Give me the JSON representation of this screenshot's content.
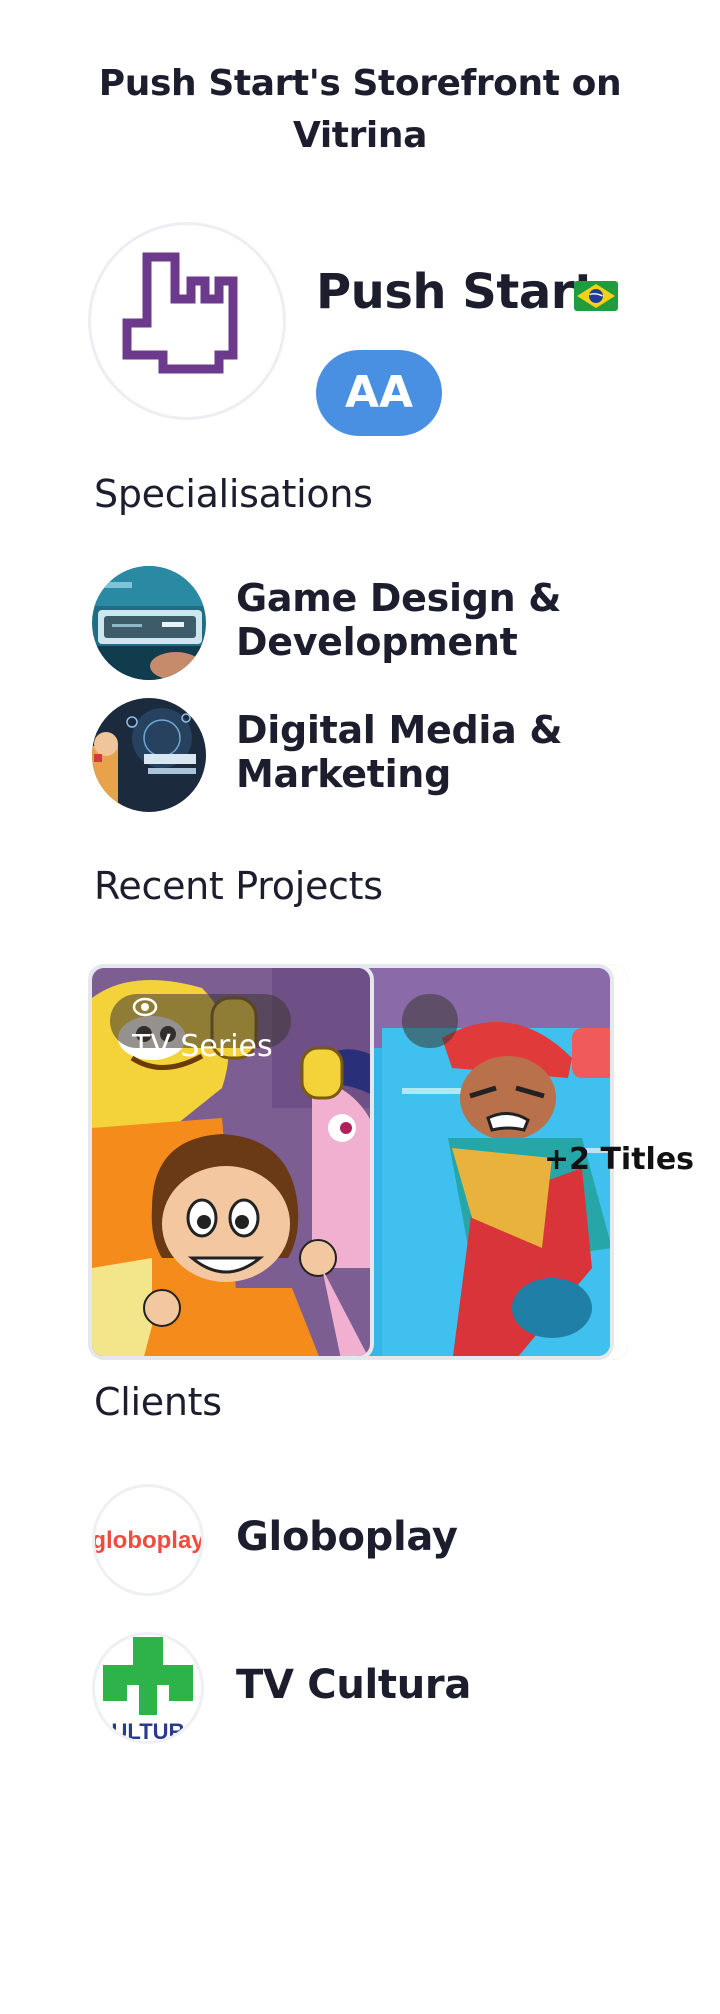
{
  "page": {
    "title_line1": "Push Start's Storefront on",
    "title_line2": "Vitrina"
  },
  "profile": {
    "name": "Push Start",
    "flag_icon": "brazil-flag",
    "badge": "AA",
    "badge_color": "#4a90e2",
    "brand_color": "#6b3a8c"
  },
  "specialisations": {
    "heading": "Specialisations",
    "items": [
      {
        "line1": "Game Design &",
        "line2": "Development"
      },
      {
        "line1": "Digital Media &",
        "line2": "Marketing"
      }
    ]
  },
  "projects": {
    "heading": "Recent Projects",
    "cards": [
      {
        "chip": "TV Series",
        "icon": "eye-icon"
      },
      {
        "chip": "",
        "icon": "eye-icon"
      },
      {
        "chip": "",
        "icon": "eye-icon"
      }
    ],
    "more_label": "+2 Titles"
  },
  "clients": {
    "heading": "Clients",
    "items": [
      {
        "name": "Globoplay",
        "logo_text": "globoplay",
        "logo_color": "#ef4b3e"
      },
      {
        "name": "TV Cultura",
        "logo_text": "ULTUR",
        "logo_color": "#2db34a"
      }
    ]
  }
}
